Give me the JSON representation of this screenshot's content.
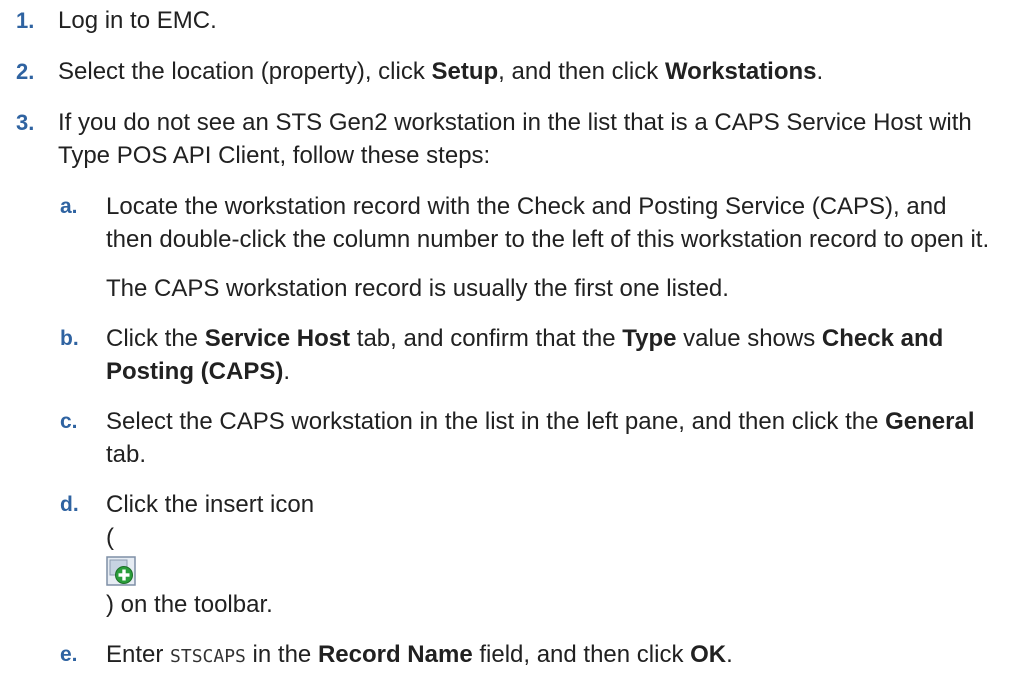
{
  "steps": [
    {
      "number": "1.",
      "text": "Log in to EMC."
    },
    {
      "number": "2.",
      "text_before": "Select the location (property), click ",
      "setup": "Setup",
      "text_mid": ", and then click ",
      "workstations": "Workstations",
      "text_after": "."
    },
    {
      "number": "3.",
      "text": "If you do not see an STS Gen2 workstation in the list that is a CAPS Service Host with Type POS API Client, follow these steps:",
      "substeps": {
        "a": {
          "number": "a.",
          "text": "Locate the workstation record with the Check and Posting Service (CAPS), and then double-click the column number to the left of this workstation record to open it.",
          "note": "The CAPS workstation record is usually the first one listed."
        },
        "b": {
          "number": "b.",
          "text_before": "Click the ",
          "service_host": "Service Host",
          "text_mid1": " tab, and confirm that the ",
          "type": "Type",
          "text_mid2": " value shows ",
          "value": "Check and Posting (CAPS)",
          "text_after": "."
        },
        "c": {
          "number": "c.",
          "text_before": "Select the CAPS workstation in the list in the left pane, and then click the ",
          "general": "General",
          "text_after": " tab."
        },
        "d": {
          "number": "d.",
          "text_before": "Click the insert icon",
          "open_paren": "(",
          "icon_name": "insert-record-icon",
          "close_text": ") on the toolbar."
        },
        "e": {
          "number": "e.",
          "text_before": "Enter ",
          "code": "STSCAPS",
          "text_mid1": " in the ",
          "record_name": "Record Name",
          "text_mid2": " field, and then click ",
          "ok": "OK",
          "text_after": "."
        }
      }
    }
  ],
  "colors": {
    "step_number": "#2f63a1",
    "text": "#212121",
    "icon_green": "#2a9d3a",
    "icon_frame": "#7f8fa6"
  }
}
